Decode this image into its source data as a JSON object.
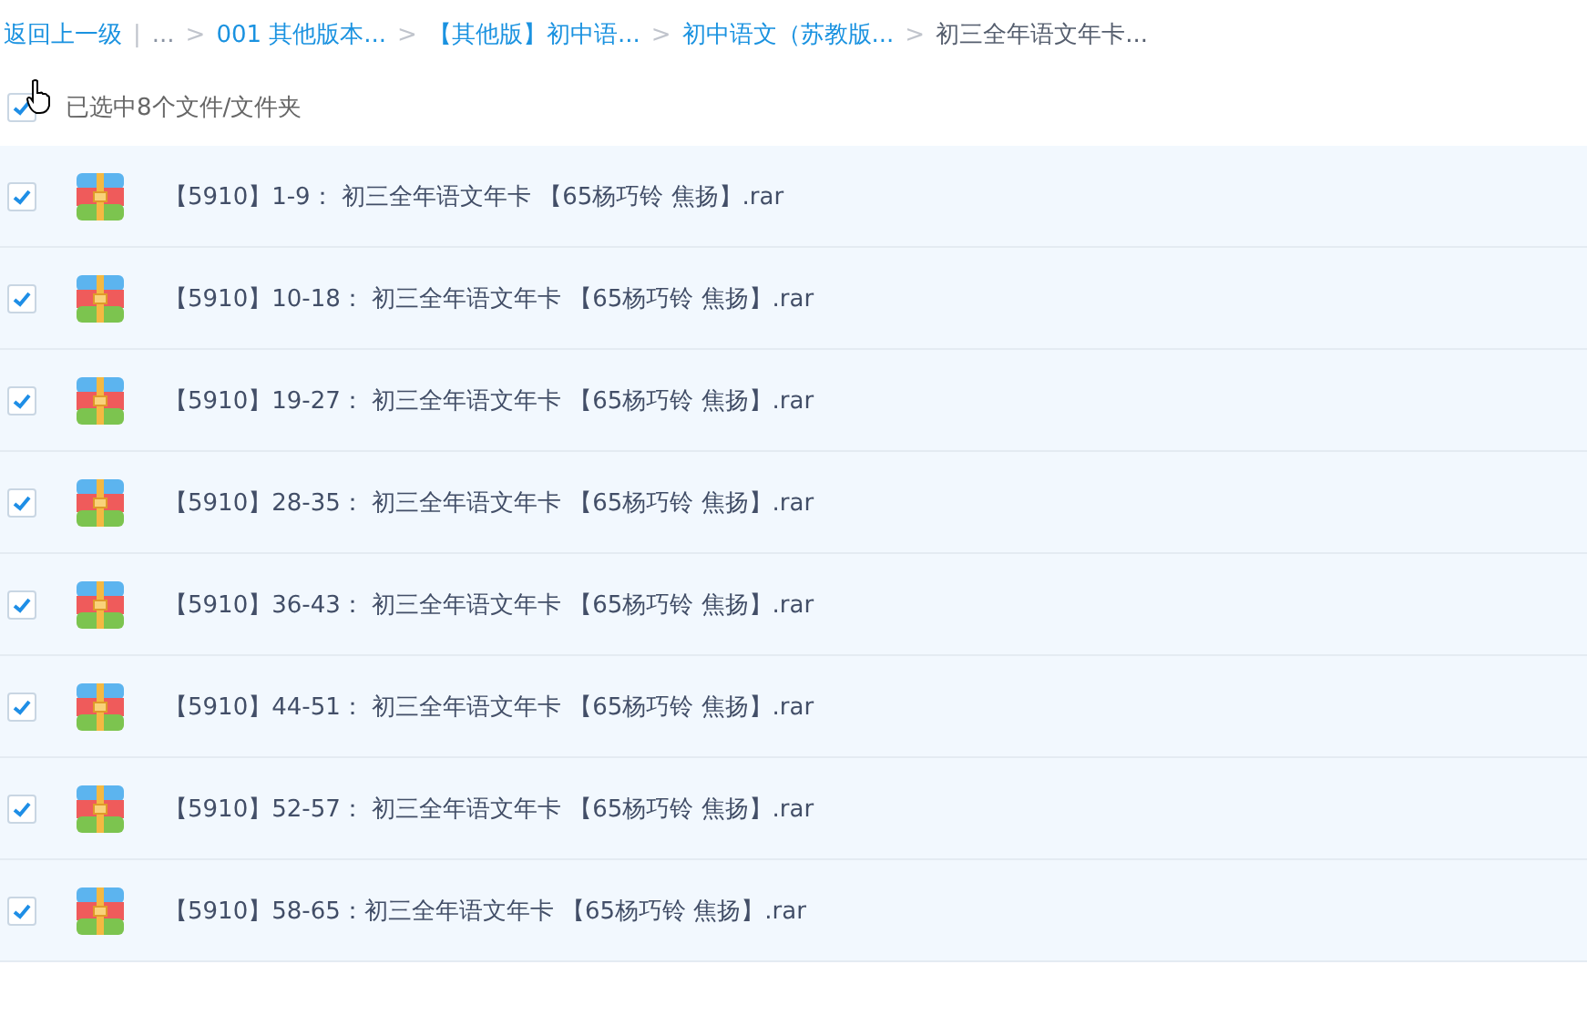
{
  "breadcrumb": [
    {
      "kind": "link",
      "text": "返回上一级"
    },
    {
      "kind": "divider",
      "text": "|"
    },
    {
      "kind": "ellipsis",
      "text": "..."
    },
    {
      "kind": "separator",
      "text": ">"
    },
    {
      "kind": "link",
      "text": "001 其他版本..."
    },
    {
      "kind": "separator",
      "text": ">"
    },
    {
      "kind": "link",
      "text": "【其他版】初中语..."
    },
    {
      "kind": "separator",
      "text": ">"
    },
    {
      "kind": "link",
      "text": "初中语文（苏教版..."
    },
    {
      "kind": "separator",
      "text": ">"
    },
    {
      "kind": "current",
      "text": "初三全年语文年卡..."
    }
  ],
  "select_all": {
    "checked": true,
    "label": "已选中8个文件/文件夹"
  },
  "files": [
    {
      "name": "【5910】1-9： 初三全年语文年卡 【65杨巧铃 焦扬】.rar",
      "checked": true
    },
    {
      "name": "【5910】10-18： 初三全年语文年卡 【65杨巧铃 焦扬】.rar",
      "checked": true
    },
    {
      "name": "【5910】19-27： 初三全年语文年卡 【65杨巧铃 焦扬】.rar",
      "checked": true
    },
    {
      "name": "【5910】28-35： 初三全年语文年卡 【65杨巧铃 焦扬】.rar",
      "checked": true
    },
    {
      "name": "【5910】36-43： 初三全年语文年卡 【65杨巧铃 焦扬】.rar",
      "checked": true
    },
    {
      "name": "【5910】44-51： 初三全年语文年卡 【65杨巧铃 焦扬】.rar",
      "checked": true
    },
    {
      "name": "【5910】52-57： 初三全年语文年卡 【65杨巧铃 焦扬】.rar",
      "checked": true
    },
    {
      "name": "【5910】58-65：初三全年语文年卡 【65杨巧铃 焦扬】.rar",
      "checked": true
    }
  ]
}
